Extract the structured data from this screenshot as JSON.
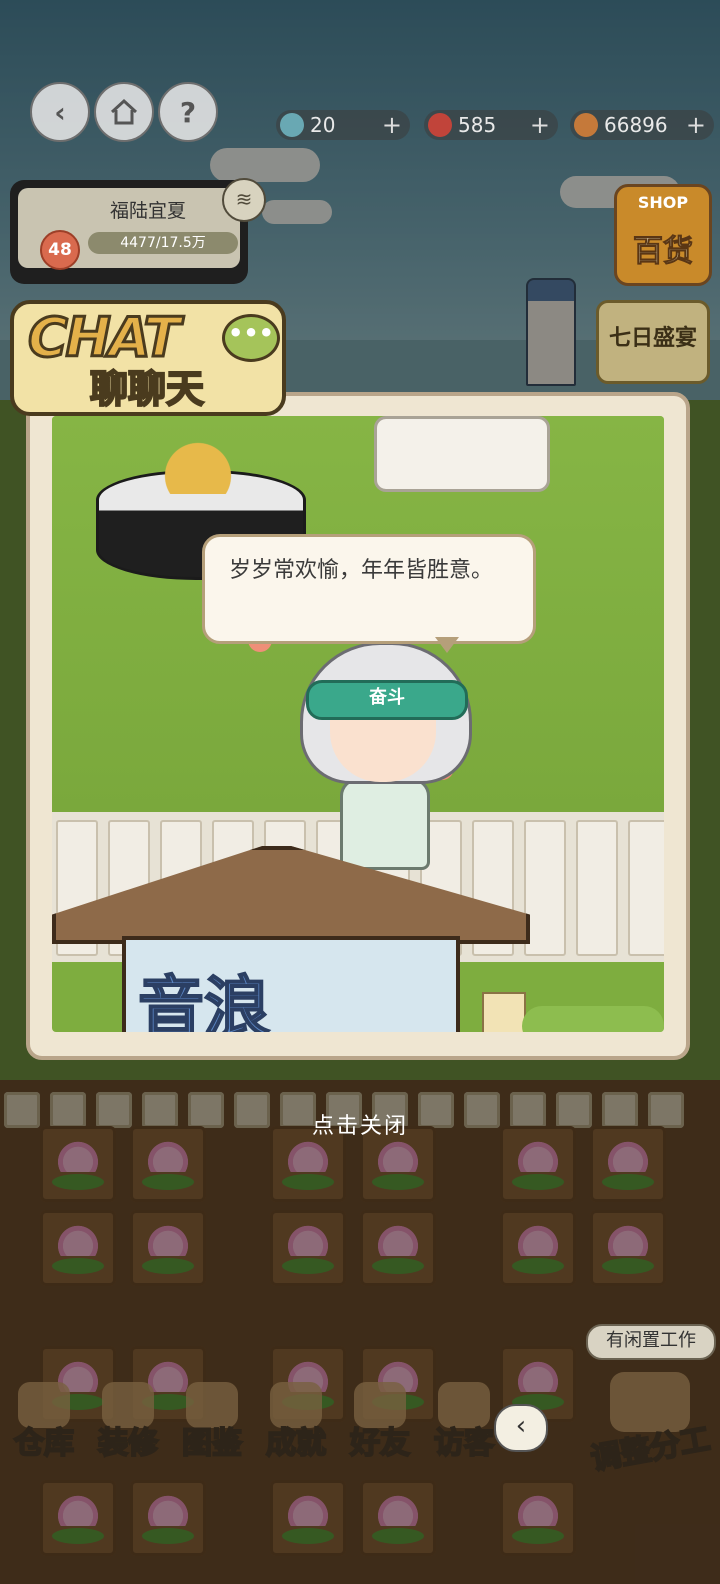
{
  "topbar": {
    "back_icon": "back-arrow-icon",
    "home_icon": "home-icon",
    "help_label": "?",
    "resources": [
      {
        "name": "gem",
        "icon": "gem-icon",
        "value": "20",
        "plus": "+"
      },
      {
        "name": "feather",
        "icon": "feather-icon",
        "value": "585",
        "plus": "+"
      },
      {
        "name": "coin",
        "icon": "coin-icon",
        "value": "66896",
        "plus": "+"
      }
    ]
  },
  "farm_card": {
    "name": "福陆宜夏",
    "level": "48",
    "xp": "4477/17.5万"
  },
  "right_side": {
    "shop_en": "SHOP",
    "shop_zh": "百货",
    "seven_day": "七日盛宴"
  },
  "chat": {
    "badge_title": "CHAT",
    "badge_sub": "聊聊天",
    "badge_bubble": "•••",
    "speech": "岁岁常欢愉，年年皆胜意。",
    "headband_text": "奋斗",
    "sign_text": "音浪"
  },
  "close_tip": "点击关闭",
  "nav": {
    "items": [
      {
        "label": "仓库",
        "icon": "warehouse-icon"
      },
      {
        "label": "装修",
        "icon": "hammer-icon"
      },
      {
        "label": "图鉴",
        "icon": "book-icon"
      },
      {
        "label": "成就",
        "icon": "trophy-icon"
      },
      {
        "label": "好友",
        "icon": "friends-icon"
      },
      {
        "label": "访客",
        "icon": "phone-icon"
      }
    ],
    "arrow": "‹",
    "idle_tag": "有闲置工作",
    "dispatch": "调整分工"
  },
  "colors": {
    "accent": "#e4b14a",
    "grass": "#7ead3f",
    "headband": "#3aa88b"
  }
}
